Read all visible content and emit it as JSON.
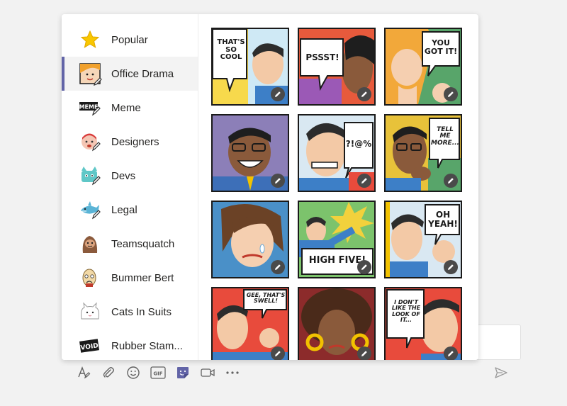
{
  "categories": [
    {
      "label": "Popular",
      "icon": "star-icon"
    },
    {
      "label": "Office Drama",
      "icon": "office-drama-icon",
      "active": true
    },
    {
      "label": "Meme",
      "icon": "meme-icon"
    },
    {
      "label": "Designers",
      "icon": "designers-icon"
    },
    {
      "label": "Devs",
      "icon": "devs-icon"
    },
    {
      "label": "Legal",
      "icon": "legal-shark-icon"
    },
    {
      "label": "Teamsquatch",
      "icon": "teamsquatch-icon"
    },
    {
      "label": "Bummer Bert",
      "icon": "bummer-bert-icon"
    },
    {
      "label": "Cats In Suits",
      "icon": "cats-in-suits-icon"
    },
    {
      "label": "Rubber Stam...",
      "icon": "rubber-stamp-icon"
    }
  ],
  "sidebar_icon_text": {
    "meme": "MEME",
    "void": "VOID"
  },
  "stickers": {
    "s1": "THAT'S SO COOL",
    "s2": "PSSST!",
    "s3": "YOU GOT IT!",
    "s5": "?!@%",
    "s6": "TELL ME MORE...",
    "s8": "HIGH FIVE!",
    "s9": "OH YEAH!",
    "s10": "GEE, THAT'S SWELL!",
    "s12": "I DON'T LIKE THE LOOK OF IT..."
  },
  "toolbar": [
    "format-icon",
    "attach-icon",
    "emoji-icon",
    "gif-icon",
    "sticker-icon",
    "meet-icon",
    "more-icon"
  ],
  "toolbar_text": {
    "gif": "GIF"
  },
  "colors": {
    "accent": "#6264a7",
    "active_bg": "#f3f3f3"
  }
}
